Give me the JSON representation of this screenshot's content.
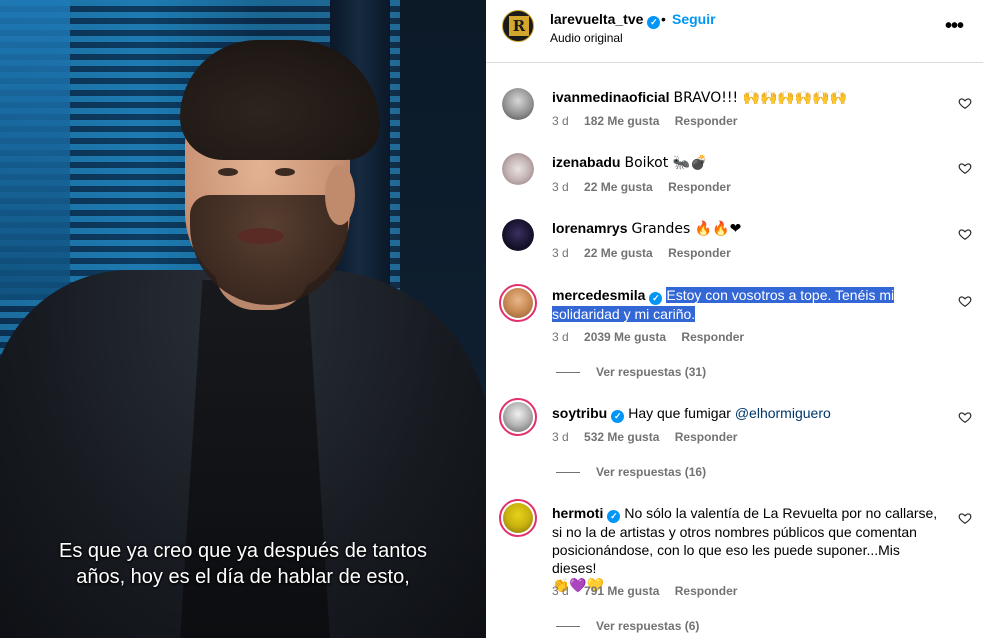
{
  "video": {
    "subtitle_lines": [
      "Es que ya creo que ya después de tantos",
      "años, hoy es el día de hablar de esto,"
    ]
  },
  "header": {
    "username": "larevuelta_tve",
    "dot": "•",
    "follow_label": "Seguir",
    "audio_label": "Audio original",
    "more_icon": "more-horizontal-icon"
  },
  "comments": [
    {
      "username": "ivanmedinaoficial",
      "text": "BRAVO!!! 🙌🙌🙌🙌🙌🙌",
      "age": "3 d",
      "likes": "182 Me gusta",
      "reply": "Responder"
    },
    {
      "username": "izenabadu",
      "text": "Boikot 🐜💣",
      "age": "3 d",
      "likes": "22 Me gusta",
      "reply": "Responder"
    },
    {
      "username": "lorenamrys",
      "text": "Grandes 🔥🔥❤",
      "age": "3 d",
      "likes": "22 Me gusta",
      "reply": "Responder"
    },
    {
      "username": "mercedesmila",
      "text": "Estoy con vosotros a tope. Tenéis mi solidaridad y mi cariño.",
      "age": "3 d",
      "likes": "2039 Me gusta",
      "reply": "Responder",
      "view_replies": "Ver respuestas (31)"
    },
    {
      "username": "soytribu",
      "text_prefix": "Hay que fumigar ",
      "mention": "@elhormiguero",
      "age": "3 d",
      "likes": "532 Me gusta",
      "reply": "Responder",
      "view_replies": "Ver respuestas (16)"
    },
    {
      "username": "hermoti",
      "text": "No sólo la valentía de La Revuelta por no callarse, si no la de artistas y otros nombres públicos que comentan posicionándose, con lo que eso les puede suponer...Mis dieses!",
      "emoji_line": "👏💜💛",
      "age": "3 d",
      "likes": "791 Me gusta",
      "reply": "Responder",
      "view_replies": "Ver respuestas (6)"
    }
  ],
  "colors": {
    "accent": "#0095f6",
    "highlight": "#3367d6",
    "meta": "#737373",
    "mention": "#00376b"
  }
}
